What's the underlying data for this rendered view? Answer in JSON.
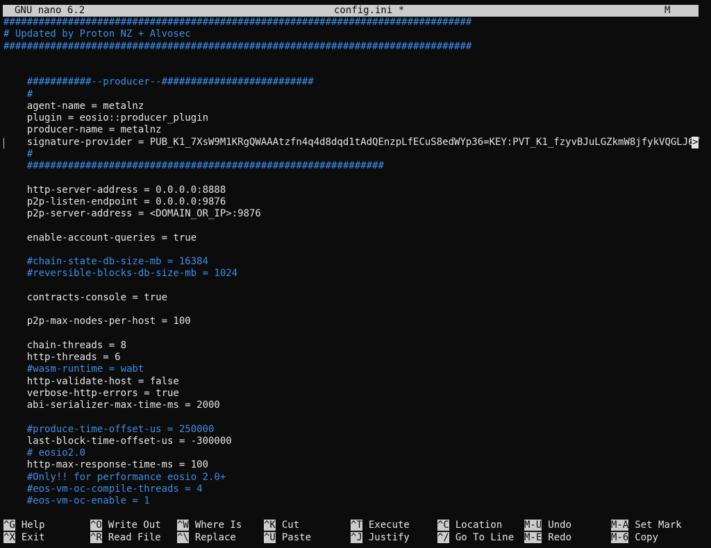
{
  "titlebar": {
    "app": "GNU nano 6.2",
    "filename": "config.ini *",
    "mode": "M"
  },
  "editor": {
    "lines": [
      {
        "text": "################################################################################",
        "type": "comment"
      },
      {
        "text": "# Updated by Proton NZ + Alvosec",
        "type": "comment"
      },
      {
        "text": "################################################################################",
        "type": "comment"
      },
      {
        "text": "",
        "type": "plain"
      },
      {
        "text": "",
        "type": "plain"
      },
      {
        "text": "    ###########--producer--##########################",
        "type": "comment"
      },
      {
        "text": "    #",
        "type": "comment"
      },
      {
        "text": "    agent-name = metalnz",
        "type": "plain"
      },
      {
        "text": "    plugin = eosio::producer_plugin",
        "type": "plain"
      },
      {
        "text": "    producer-name = metalnz",
        "type": "plain"
      },
      {
        "text": "    signature-provider = PUB_K1_7XsW9M1KRgQWAAAtzfn4q4d8dqd1tAdQEnzpLfECuS8edWYp36=KEY:PVT_K1_fzyvBJuLGZkmW8jfykVQGLJ6T",
        "type": "plain"
      },
      {
        "text": "    #",
        "type": "comment"
      },
      {
        "text": "    #############################################################",
        "type": "comment"
      },
      {
        "text": "",
        "type": "plain"
      },
      {
        "text": "    http-server-address = 0.0.0.0:8888",
        "type": "plain"
      },
      {
        "text": "    p2p-listen-endpoint = 0.0.0.0:9876",
        "type": "plain"
      },
      {
        "text": "    p2p-server-address = <DOMAIN_OR_IP>:9876",
        "type": "plain"
      },
      {
        "text": "",
        "type": "plain"
      },
      {
        "text": "    enable-account-queries = true",
        "type": "plain"
      },
      {
        "text": "",
        "type": "plain"
      },
      {
        "text": "    #chain-state-db-size-mb = 16384",
        "type": "comment"
      },
      {
        "text": "    #reversible-blocks-db-size-mb = 1024",
        "type": "comment"
      },
      {
        "text": "",
        "type": "plain"
      },
      {
        "text": "    contracts-console = true",
        "type": "plain"
      },
      {
        "text": "",
        "type": "plain"
      },
      {
        "text": "    p2p-max-nodes-per-host = 100",
        "type": "plain"
      },
      {
        "text": "",
        "type": "plain"
      },
      {
        "text": "    chain-threads = 8",
        "type": "plain"
      },
      {
        "text": "    http-threads = 6",
        "type": "plain"
      },
      {
        "text": "    #wasm-runtime = wabt",
        "type": "comment"
      },
      {
        "text": "    http-validate-host = false",
        "type": "plain"
      },
      {
        "text": "    verbose-http-errors = true",
        "type": "plain"
      },
      {
        "text": "    abi-serializer-max-time-ms = 2000",
        "type": "plain"
      },
      {
        "text": "",
        "type": "plain"
      },
      {
        "text": "    #produce-time-offset-us = 250000",
        "type": "comment"
      },
      {
        "text": "    last-block-time-offset-us = -300000",
        "type": "plain"
      },
      {
        "text": "    # eosio2.0",
        "type": "comment"
      },
      {
        "text": "    http-max-response-time-ms = 100",
        "type": "plain"
      },
      {
        "text": "    #Only!! for performance eosio 2.0+",
        "type": "comment"
      },
      {
        "text": "    #eos-vm-oc-compile-threads = 4",
        "type": "comment"
      },
      {
        "text": "    #eos-vm-oc-enable = 1",
        "type": "comment"
      }
    ],
    "overflow_marker": ">"
  },
  "shortcuts": [
    {
      "key": "^G",
      "label": "Help"
    },
    {
      "key": "^O",
      "label": "Write Out"
    },
    {
      "key": "^W",
      "label": "Where Is"
    },
    {
      "key": "^K",
      "label": "Cut"
    },
    {
      "key": "^T",
      "label": "Execute"
    },
    {
      "key": "^C",
      "label": "Location"
    },
    {
      "key": "M-U",
      "label": "Undo"
    },
    {
      "key": "M-A",
      "label": "Set Mark"
    },
    {
      "key": "^X",
      "label": "Exit"
    },
    {
      "key": "^R",
      "label": "Read File"
    },
    {
      "key": "^\\",
      "label": "Replace"
    },
    {
      "key": "^U",
      "label": "Paste"
    },
    {
      "key": "^J",
      "label": "Justify"
    },
    {
      "key": "^/",
      "label": "Go To Line"
    },
    {
      "key": "M-E",
      "label": "Redo"
    },
    {
      "key": "M-6",
      "label": "Copy"
    }
  ],
  "colors": {
    "background": "#0c0c0c",
    "comment": "#3b8eea",
    "text": "#e5e5e5",
    "titlebar": "#cccccc"
  }
}
